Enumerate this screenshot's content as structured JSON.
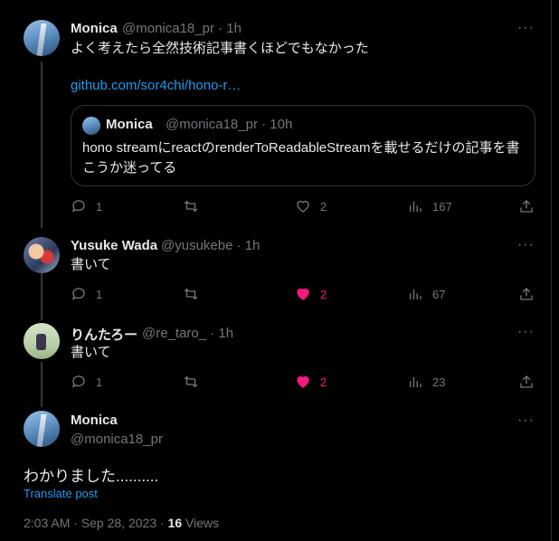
{
  "tweet1": {
    "name": "Monica",
    "handle": "@monica18_pr · 1h",
    "text": "よく考えたら全然技術記事書くほどでもなかった",
    "link": "github.com/sor4chi/hono-r…",
    "more": "···",
    "quote": {
      "name": "Monica",
      "handle": "@monica18_pr · 10h",
      "text": "hono streamにreactのrenderToReadableStreamを載せるだけの記事を書こうか迷ってる"
    },
    "actions": {
      "replies": "1",
      "likes": "2",
      "views": "167"
    }
  },
  "tweet2": {
    "name": "Yusuke Wada",
    "handle": "@yusukebe · 1h",
    "text": "書いて",
    "more": "···",
    "actions": {
      "replies": "1",
      "likes": "2",
      "views": "67"
    }
  },
  "tweet3": {
    "name": "りんたろー",
    "handle": "@re_taro_ · 1h",
    "text": "書いて",
    "more": "···",
    "actions": {
      "replies": "1",
      "likes": "2",
      "views": "23"
    }
  },
  "main": {
    "name": "Monica",
    "handle": "@monica18_pr",
    "more": "···",
    "text": "わかりました..........",
    "translate": "Translate post",
    "time": "2:03 AM · Sep 28, 2023 · ",
    "views_count": "16",
    "views_label": " Views"
  },
  "colors": {
    "background": "#000000",
    "link": "#1d9bf0",
    "like": "#f91880",
    "muted": "#71767b"
  }
}
